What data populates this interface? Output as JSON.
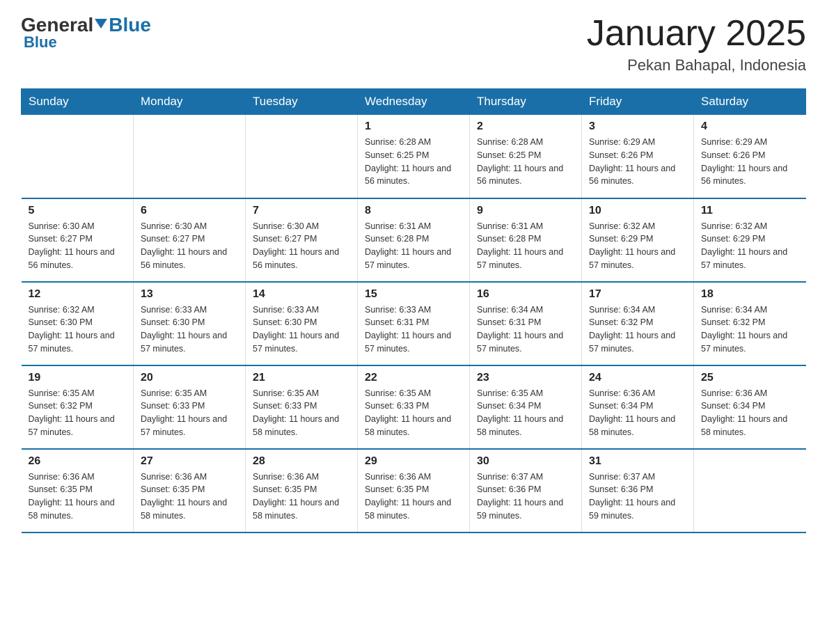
{
  "header": {
    "logo_general": "General",
    "logo_blue": "Blue",
    "title": "January 2025",
    "subtitle": "Pekan Bahapal, Indonesia"
  },
  "days_of_week": [
    "Sunday",
    "Monday",
    "Tuesday",
    "Wednesday",
    "Thursday",
    "Friday",
    "Saturday"
  ],
  "weeks": [
    [
      {
        "day": "",
        "info": ""
      },
      {
        "day": "",
        "info": ""
      },
      {
        "day": "",
        "info": ""
      },
      {
        "day": "1",
        "info": "Sunrise: 6:28 AM\nSunset: 6:25 PM\nDaylight: 11 hours and 56 minutes."
      },
      {
        "day": "2",
        "info": "Sunrise: 6:28 AM\nSunset: 6:25 PM\nDaylight: 11 hours and 56 minutes."
      },
      {
        "day": "3",
        "info": "Sunrise: 6:29 AM\nSunset: 6:26 PM\nDaylight: 11 hours and 56 minutes."
      },
      {
        "day": "4",
        "info": "Sunrise: 6:29 AM\nSunset: 6:26 PM\nDaylight: 11 hours and 56 minutes."
      }
    ],
    [
      {
        "day": "5",
        "info": "Sunrise: 6:30 AM\nSunset: 6:27 PM\nDaylight: 11 hours and 56 minutes."
      },
      {
        "day": "6",
        "info": "Sunrise: 6:30 AM\nSunset: 6:27 PM\nDaylight: 11 hours and 56 minutes."
      },
      {
        "day": "7",
        "info": "Sunrise: 6:30 AM\nSunset: 6:27 PM\nDaylight: 11 hours and 56 minutes."
      },
      {
        "day": "8",
        "info": "Sunrise: 6:31 AM\nSunset: 6:28 PM\nDaylight: 11 hours and 57 minutes."
      },
      {
        "day": "9",
        "info": "Sunrise: 6:31 AM\nSunset: 6:28 PM\nDaylight: 11 hours and 57 minutes."
      },
      {
        "day": "10",
        "info": "Sunrise: 6:32 AM\nSunset: 6:29 PM\nDaylight: 11 hours and 57 minutes."
      },
      {
        "day": "11",
        "info": "Sunrise: 6:32 AM\nSunset: 6:29 PM\nDaylight: 11 hours and 57 minutes."
      }
    ],
    [
      {
        "day": "12",
        "info": "Sunrise: 6:32 AM\nSunset: 6:30 PM\nDaylight: 11 hours and 57 minutes."
      },
      {
        "day": "13",
        "info": "Sunrise: 6:33 AM\nSunset: 6:30 PM\nDaylight: 11 hours and 57 minutes."
      },
      {
        "day": "14",
        "info": "Sunrise: 6:33 AM\nSunset: 6:30 PM\nDaylight: 11 hours and 57 minutes."
      },
      {
        "day": "15",
        "info": "Sunrise: 6:33 AM\nSunset: 6:31 PM\nDaylight: 11 hours and 57 minutes."
      },
      {
        "day": "16",
        "info": "Sunrise: 6:34 AM\nSunset: 6:31 PM\nDaylight: 11 hours and 57 minutes."
      },
      {
        "day": "17",
        "info": "Sunrise: 6:34 AM\nSunset: 6:32 PM\nDaylight: 11 hours and 57 minutes."
      },
      {
        "day": "18",
        "info": "Sunrise: 6:34 AM\nSunset: 6:32 PM\nDaylight: 11 hours and 57 minutes."
      }
    ],
    [
      {
        "day": "19",
        "info": "Sunrise: 6:35 AM\nSunset: 6:32 PM\nDaylight: 11 hours and 57 minutes."
      },
      {
        "day": "20",
        "info": "Sunrise: 6:35 AM\nSunset: 6:33 PM\nDaylight: 11 hours and 57 minutes."
      },
      {
        "day": "21",
        "info": "Sunrise: 6:35 AM\nSunset: 6:33 PM\nDaylight: 11 hours and 58 minutes."
      },
      {
        "day": "22",
        "info": "Sunrise: 6:35 AM\nSunset: 6:33 PM\nDaylight: 11 hours and 58 minutes."
      },
      {
        "day": "23",
        "info": "Sunrise: 6:35 AM\nSunset: 6:34 PM\nDaylight: 11 hours and 58 minutes."
      },
      {
        "day": "24",
        "info": "Sunrise: 6:36 AM\nSunset: 6:34 PM\nDaylight: 11 hours and 58 minutes."
      },
      {
        "day": "25",
        "info": "Sunrise: 6:36 AM\nSunset: 6:34 PM\nDaylight: 11 hours and 58 minutes."
      }
    ],
    [
      {
        "day": "26",
        "info": "Sunrise: 6:36 AM\nSunset: 6:35 PM\nDaylight: 11 hours and 58 minutes."
      },
      {
        "day": "27",
        "info": "Sunrise: 6:36 AM\nSunset: 6:35 PM\nDaylight: 11 hours and 58 minutes."
      },
      {
        "day": "28",
        "info": "Sunrise: 6:36 AM\nSunset: 6:35 PM\nDaylight: 11 hours and 58 minutes."
      },
      {
        "day": "29",
        "info": "Sunrise: 6:36 AM\nSunset: 6:35 PM\nDaylight: 11 hours and 58 minutes."
      },
      {
        "day": "30",
        "info": "Sunrise: 6:37 AM\nSunset: 6:36 PM\nDaylight: 11 hours and 59 minutes."
      },
      {
        "day": "31",
        "info": "Sunrise: 6:37 AM\nSunset: 6:36 PM\nDaylight: 11 hours and 59 minutes."
      },
      {
        "day": "",
        "info": ""
      }
    ]
  ]
}
